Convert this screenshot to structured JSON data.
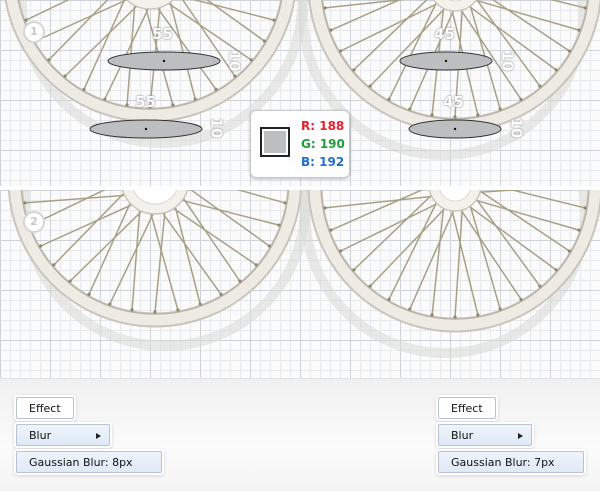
{
  "steps": [
    "1",
    "2"
  ],
  "dimensions": {
    "left_top_width": "55",
    "left_top_height": "10",
    "left_bottom_width": "55",
    "left_bottom_height": "10",
    "right_top_width": "45",
    "right_top_height": "10",
    "right_bottom_width": "45",
    "right_bottom_height": "10"
  },
  "color": {
    "r_label": "R: 188",
    "g_label": "G: 190",
    "b_label": "B: 192",
    "swatch_hex": "#bcbec0",
    "r_color": "#e8212b",
    "g_color": "#1e9d3c",
    "b_color": "#1f6fd0"
  },
  "menus": {
    "left": {
      "effect": "Effect",
      "blur": "Blur",
      "gaussian": "Gaussian Blur: 8px"
    },
    "right": {
      "effect": "Effect",
      "blur": "Blur",
      "gaussian": "Gaussian Blur: 7px"
    }
  },
  "icons": {
    "submenu_arrow": "triangle-right-icon"
  }
}
